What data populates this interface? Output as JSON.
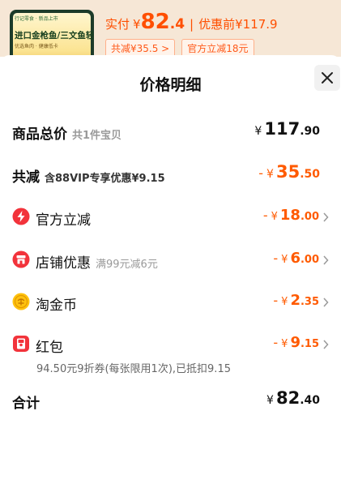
{
  "header": {
    "product_tag": "行记零食 · 新品上市",
    "product_line1": "进口金枪鱼/三文鱼轻食",
    "product_line2": "优选鱼肉 · 健康低卡",
    "price_label": "实付",
    "currency": "¥",
    "price_int": "82",
    "price_dec": ".4",
    "separator": "|",
    "original_price": "优惠前¥117.9",
    "chip_total_discount": "共减¥35.5 >",
    "chip_official": "官方立减18元"
  },
  "sheet": {
    "title": "价格明细",
    "rows": [
      {
        "label": "商品总价",
        "note": "共1件宝贝",
        "sign": "",
        "currency": "¥",
        "int": "117",
        "dec": ".90"
      },
      {
        "label": "共减",
        "note": "含88VIP专享优惠¥9.15",
        "sign": "-",
        "currency": "¥",
        "int": "35",
        "dec": ".50"
      },
      {
        "label": "官方立减",
        "note": "",
        "sign": "-",
        "currency": "¥",
        "int": "18",
        "dec": ".00",
        "icon": "lightning-icon"
      },
      {
        "label": "店铺优惠",
        "note": "满99元减6元",
        "sign": "-",
        "currency": "¥",
        "int": "6",
        "dec": ".00",
        "icon": "store-icon"
      },
      {
        "label": "淘金币",
        "note": "",
        "sign": "-",
        "currency": "¥",
        "int": "2",
        "dec": ".35",
        "icon": "gold-coin-icon"
      },
      {
        "label": "红包",
        "note": "",
        "sign": "-",
        "currency": "¥",
        "int": "9",
        "dec": ".15",
        "icon": "red-packet-icon"
      },
      {
        "label": "合计",
        "note": "",
        "sign": "",
        "currency": "¥",
        "int": "82",
        "dec": ".40"
      }
    ],
    "red_packet_detail": "94.50元9折券(每张限用1次),已抵扣9.15"
  },
  "colors": {
    "accent": "#ff5a00",
    "text": "#111111",
    "muted": "#9a9a9a"
  }
}
